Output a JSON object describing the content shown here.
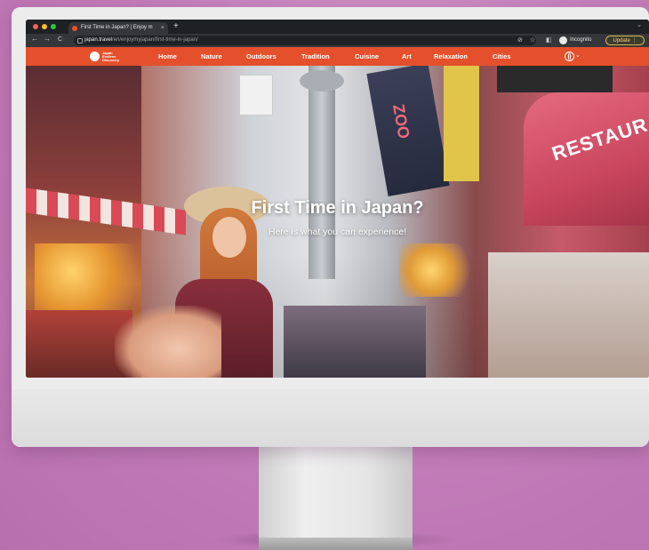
{
  "browser": {
    "tab_title": "First Time in Japan? | Enjoy m",
    "tab_close": "×",
    "new_tab": "+",
    "tab_caret": "⌄",
    "url_host": "japan.travel",
    "url_path": "/en/enjoymyjapan/first-time-in-japan/",
    "back": "←",
    "forward": "→",
    "reload": "C",
    "incognito_label": "Incognito",
    "update_label": "Update ⋮",
    "colors": {
      "close": "#ff5f57",
      "minimize": "#febc2e",
      "zoom": "#28c840"
    }
  },
  "site": {
    "logo_line1": "Japan",
    "logo_line2": "Endless",
    "logo_line3": "Discovery",
    "nav": [
      "Home",
      "Nature",
      "Outdoors",
      "Tradition",
      "Cuisine",
      "Art",
      "Relaxation",
      "Cities"
    ],
    "language_icon": "globe-icon",
    "accent_color": "#e4502b"
  },
  "hero": {
    "title": "First Time in Japan?",
    "subtitle": "Here is what you can experience!",
    "sign_restaurant": "RESTAUR",
    "sign_zoo": "ZOO"
  }
}
